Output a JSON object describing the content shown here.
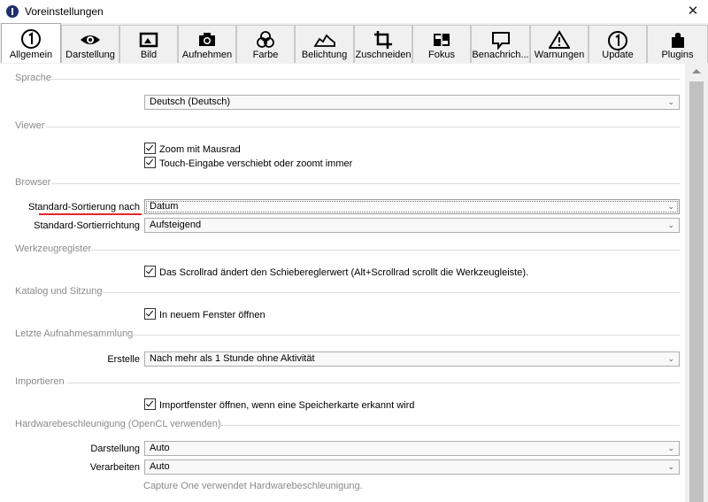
{
  "window": {
    "title": "Voreinstellungen",
    "close": "✕"
  },
  "tabs": [
    {
      "label": "Allgemein",
      "icon": "info-circle-icon",
      "active": true
    },
    {
      "label": "Darstellung",
      "icon": "eye-icon"
    },
    {
      "label": "Bild",
      "icon": "image-icon"
    },
    {
      "label": "Aufnehmen",
      "icon": "camera-icon"
    },
    {
      "label": "Farbe",
      "icon": "color-circles-icon"
    },
    {
      "label": "Belichtung",
      "icon": "exposure-icon"
    },
    {
      "label": "Zuschneiden",
      "icon": "crop-icon"
    },
    {
      "label": "Fokus",
      "icon": "focus-icon"
    },
    {
      "label": "Benachrich...",
      "icon": "speech-bubble-icon"
    },
    {
      "label": "Warnungen",
      "icon": "warning-icon"
    },
    {
      "label": "Update",
      "icon": "update-icon"
    },
    {
      "label": "Plugins",
      "icon": "puzzle-icon"
    }
  ],
  "sections": {
    "sprache": {
      "heading": "Sprache",
      "language": "Deutsch (Deutsch)"
    },
    "viewer": {
      "heading": "Viewer",
      "zoom_wheel": "Zoom mit Mausrad",
      "touch": "Touch-Eingabe verschiebt oder zoomt immer"
    },
    "browser": {
      "heading": "Browser",
      "sort_label": "Standard-Sortierung nach",
      "sort_value": "Datum",
      "dir_label": "Standard-Sortierrichtung",
      "dir_value": "Aufsteigend"
    },
    "werkzeug": {
      "heading": "Werkzeugregister",
      "scroll": "Das Scrollrad ändert den Schiebereglerwert (Alt+Scrollrad scrollt die Werkzeugleiste)."
    },
    "katalog": {
      "heading": "Katalog und Sitzung",
      "new_window": "In neuem Fenster öffnen"
    },
    "letzte": {
      "heading": "Letzte Aufnahmesammlung",
      "create_label": "Erstelle",
      "create_value": "Nach mehr als 1 Stunde ohne Aktivität"
    },
    "import": {
      "heading": "Importieren",
      "open_import": "Importfenster öffnen, wenn eine Speicherkarte erkannt wird"
    },
    "hw": {
      "heading": "Hardwarebeschleunigung (OpenCL verwenden)",
      "display_label": "Darstellung",
      "display_value": "Auto",
      "process_label": "Verarbeiten",
      "process_value": "Auto",
      "note": "Capture One verwendet Hardwarebeschleunigung."
    }
  },
  "chevron": "⌄",
  "colors": {
    "highlight": "#e0262e"
  }
}
